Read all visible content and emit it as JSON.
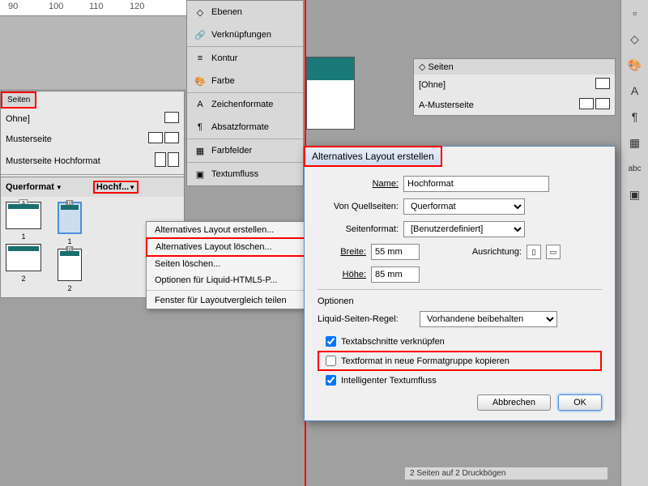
{
  "ruler": {
    "t90": "90",
    "t100": "100",
    "t110": "110",
    "t120": "120"
  },
  "left_panel": {
    "tab": "Seiten",
    "none": "Ohne]",
    "master": "Musterseite",
    "master_h": "Musterseite Hochformat",
    "layout_q": "Querformat",
    "layout_h": "Hochf",
    "page1": "1",
    "page2": "2"
  },
  "side_panels": {
    "ebenen": "Ebenen",
    "verknupf": "Verknüpfungen",
    "kontur": "Kontur",
    "farbe": "Farbe",
    "zeichen": "Zeichenformate",
    "absatz": "Absatzformate",
    "farbfelder": "Farbfelder",
    "textumfluss": "Textumfluss"
  },
  "context_menu": {
    "create": "Alternatives Layout erstellen...",
    "delete": "Alternatives Layout löschen...",
    "delete_pages": "Seiten löschen...",
    "liquid": "Optionen für Liquid-HTML5-P...",
    "compare": "Fenster für Layoutvergleich teilen"
  },
  "right_panel": {
    "tab": "Seiten",
    "none": "[Ohne]",
    "master": "A-Musterseite"
  },
  "dialog": {
    "title": "Alternatives Layout erstellen",
    "name_lbl": "Name:",
    "name_val": "Hochformat",
    "src_lbl": "Von Quellseiten:",
    "src_val": "Querformat",
    "fmt_lbl": "Seitenformat:",
    "fmt_val": "[Benutzerdefiniert]",
    "w_lbl": "Breite:",
    "w_val": "55 mm",
    "h_lbl": "Höhe:",
    "h_val": "85 mm",
    "orient_lbl": "Ausrichtung:",
    "opt_hdr": "Optionen",
    "liquid_lbl": "Liquid-Seiten-Regel:",
    "liquid_val": "Vorhandene beibehalten",
    "chk1": "Textabschnitte verknüpfen",
    "chk2": "Textformat in neue Formatgruppe kopieren",
    "chk3": "Intelligenter Textumfluss",
    "cancel": "Abbrechen",
    "ok": "OK"
  },
  "status": "2 Seiten auf 2 Druckbögen"
}
